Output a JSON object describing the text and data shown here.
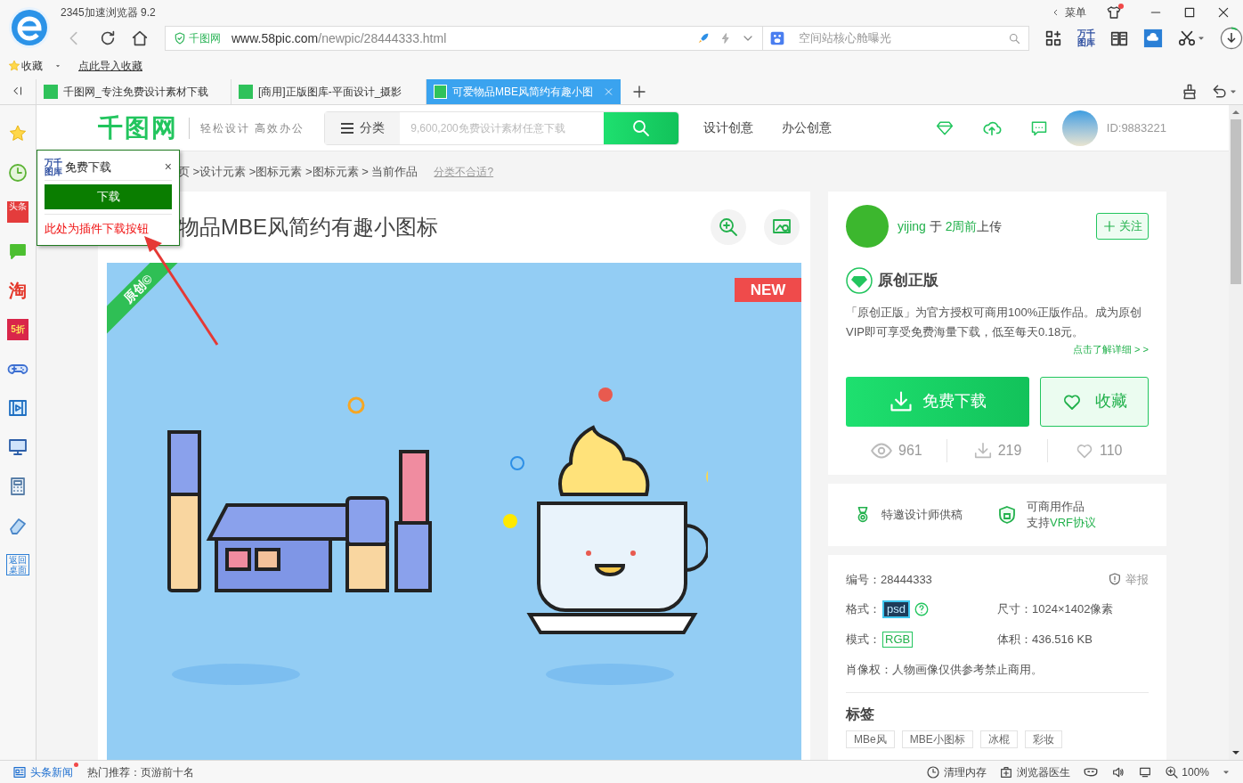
{
  "browser": {
    "title": "2345加速浏览器 9.2",
    "menu_label": "菜单",
    "address": {
      "site_label": "千图网",
      "host": "www.58pic.com",
      "path": "/newpic/28444333.html"
    },
    "search": {
      "placeholder": "空间站核心舱曝光"
    },
    "library_label": "万千图库"
  },
  "bookmarks": [
    {
      "kind": "favorites",
      "label": "收藏"
    },
    {
      "kind": "import",
      "label": "点此导入收藏"
    }
  ],
  "tabs": [
    {
      "label": "千图网_专注免费设计素材下载",
      "selected": false
    },
    {
      "label": "[商用]正版图库-平面设计_摄影",
      "selected": false
    },
    {
      "label": "可爱物品MBE风简约有趣小图",
      "selected": true
    }
  ],
  "sidebar": [
    {
      "kind": "star"
    },
    {
      "kind": "clock"
    },
    {
      "kind": "news",
      "label": "头条"
    },
    {
      "kind": "chat"
    },
    {
      "kind": "glyph",
      "label": "淘"
    },
    {
      "kind": "sale",
      "label": "5折"
    },
    {
      "kind": "gamepad"
    },
    {
      "kind": "video"
    },
    {
      "kind": "computer"
    },
    {
      "kind": "calculator"
    },
    {
      "kind": "eraser"
    },
    {
      "kind": "desktop",
      "label": "返回桌面"
    }
  ],
  "site_header": {
    "logo": "千图网",
    "slogan": "轻松设计 高效办公",
    "category": "分类",
    "search_placeholder": "9,600,200免费设计素材任意下载",
    "nav": [
      "设计创意",
      "办公创意"
    ],
    "user_id": "ID:9883221"
  },
  "plugin_popup": {
    "logo": "万千图库",
    "title": "免费下载",
    "close": "×",
    "button": "下载",
    "note": "此处为插件下载按钮"
  },
  "breadcrumb": {
    "path": "页 >设计元素 >图标元素 >图标元素 > 当前作品",
    "link": "分类不合适?"
  },
  "work": {
    "title": "物品MBE风简约有趣小图标",
    "ribbon": "原创©",
    "badge": "NEW"
  },
  "author": {
    "name": "yijing",
    "joiner": "于",
    "time": "2周前",
    "action": "上传",
    "follow": "关注"
  },
  "original": {
    "title": "原创正版",
    "description": "「原创正版」为官方授权可商用100%正版作品。成为原创VIP即可享受免费海量下载，低至每天0.18元。",
    "link": "点击了解详细 > >"
  },
  "actions": {
    "download": "免费下载",
    "favorite": "收藏"
  },
  "stats": [
    {
      "kind": "views",
      "value": "961"
    },
    {
      "kind": "downloads",
      "value": "219"
    },
    {
      "kind": "likes",
      "value": "110"
    }
  ],
  "features": [
    {
      "kind": "designer",
      "lines": [
        "特邀设计师供稿"
      ]
    },
    {
      "kind": "commercial",
      "lines": [
        "可商用作品",
        "支持**VRF协议**"
      ]
    }
  ],
  "details": {
    "id_label": "编号：",
    "id": "28444333",
    "report": "举报",
    "format_label": "格式：",
    "format": "psd",
    "size": "尺寸：1024×1402像素",
    "mode_label": "模式：",
    "mode": "RGB",
    "volume": "体积：436.516 KB",
    "rights": "肖像权：人物画像仅供参考禁止商用。"
  },
  "tags": {
    "title": "标签",
    "items": [
      "MBe风",
      "MBE小图标",
      "冰棍",
      "彩妆"
    ]
  },
  "status_bar": {
    "news": "头条新闻",
    "hot": "热门推荐：页游前十名",
    "tools": [
      {
        "kind": "memory",
        "label": "清理内存"
      },
      {
        "kind": "doctor",
        "label": "浏览器医生"
      }
    ],
    "zoom": "100%"
  }
}
